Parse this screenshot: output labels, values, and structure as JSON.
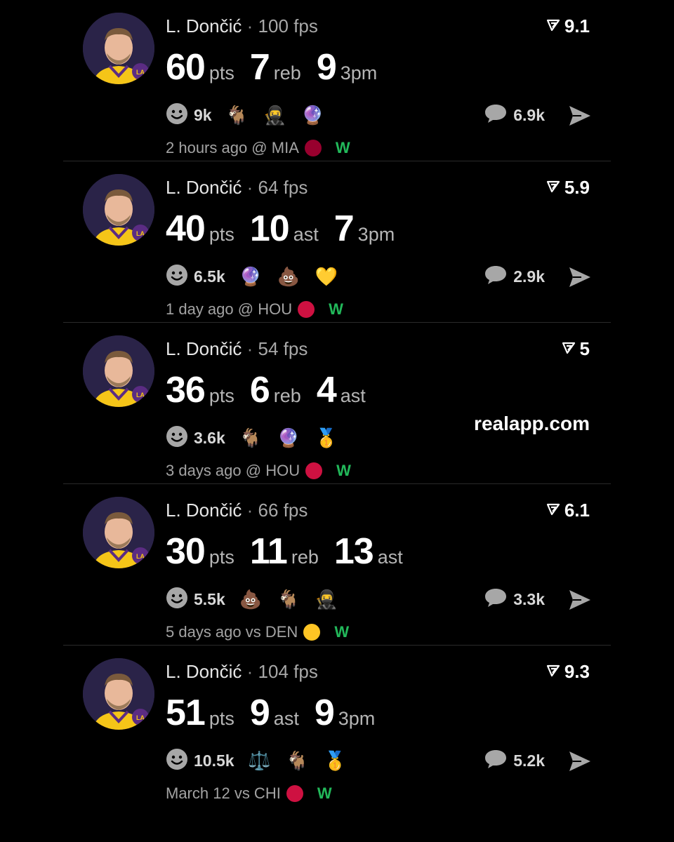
{
  "cards": [
    {
      "name": "L. Dončić",
      "sep": "·",
      "fps": "100 fps",
      "rating": "9.1",
      "stats": [
        {
          "value": "60",
          "label": "pts"
        },
        {
          "value": "7",
          "label": "reb"
        },
        {
          "value": "9",
          "label": "3pm"
        }
      ],
      "reaction_count": "9k",
      "emojis": [
        "🐐",
        "🥷",
        "🔮"
      ],
      "comments": "6.9k",
      "meta": "2 hours ago @ MIA",
      "team_logo": "heat-logo-icon",
      "team_color": "#98002e",
      "result": "W"
    },
    {
      "name": "L. Dončić",
      "sep": "·",
      "fps": "64 fps",
      "rating": "5.9",
      "stats": [
        {
          "value": "40",
          "label": "pts"
        },
        {
          "value": "10",
          "label": "ast"
        },
        {
          "value": "7",
          "label": "3pm"
        }
      ],
      "reaction_count": "6.5k",
      "emojis": [
        "🔮",
        "💩",
        "💛"
      ],
      "comments": "2.9k",
      "meta": "1 day ago @ HOU",
      "team_logo": "rockets-logo-icon",
      "team_color": "#ce1141",
      "result": "W"
    },
    {
      "name": "L. Dončić",
      "sep": "·",
      "fps": "54 fps",
      "rating": "5",
      "stats": [
        {
          "value": "36",
          "label": "pts"
        },
        {
          "value": "6",
          "label": "reb"
        },
        {
          "value": "4",
          "label": "ast"
        }
      ],
      "reaction_count": "3.6k",
      "emojis": [
        "🐐",
        "🔮",
        "🥇"
      ],
      "link": "realapp.com",
      "meta": "3 days ago @ HOU",
      "team_logo": "rockets-logo-icon",
      "team_color": "#ce1141",
      "result": "W"
    },
    {
      "name": "L. Dončić",
      "sep": "·",
      "fps": "66 fps",
      "rating": "6.1",
      "stats": [
        {
          "value": "30",
          "label": "pts"
        },
        {
          "value": "11",
          "label": "reb"
        },
        {
          "value": "13",
          "label": "ast"
        }
      ],
      "reaction_count": "5.5k",
      "emojis": [
        "💩",
        "🐐",
        "🥷"
      ],
      "comments": "3.3k",
      "meta": "5 days ago vs DEN",
      "team_logo": "nuggets-logo-icon",
      "team_color": "#fec524",
      "result": "W"
    },
    {
      "name": "L. Dončić",
      "sep": "·",
      "fps": "104 fps",
      "rating": "9.3",
      "stats": [
        {
          "value": "51",
          "label": "pts"
        },
        {
          "value": "9",
          "label": "ast"
        },
        {
          "value": "9",
          "label": "3pm"
        }
      ],
      "reaction_count": "10.5k",
      "emojis": [
        "⚖️",
        "🐐",
        "🥇"
      ],
      "comments": "5.2k",
      "meta": "March 12 vs CHI",
      "team_logo": "bulls-logo-icon",
      "team_color": "#ce1141",
      "result": "W"
    }
  ],
  "colors": {
    "background": "#000000",
    "win": "#22b85a",
    "avatar_bg": "#2a2348",
    "jersey": "#f5c518"
  }
}
